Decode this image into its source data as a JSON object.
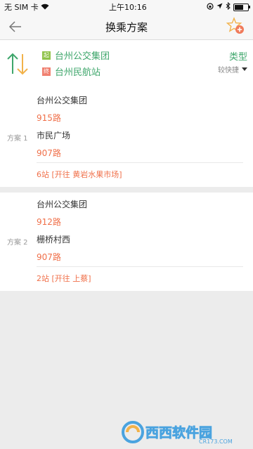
{
  "status": {
    "carrier": "无 SIM 卡",
    "time": "上午10:16"
  },
  "nav": {
    "title": "换乘方案"
  },
  "route": {
    "from_tag": "起",
    "to_tag": "终",
    "from": "台州公交集团",
    "to": "台州民航站",
    "type_label": "类型",
    "type_value": "较快捷"
  },
  "plans": [
    {
      "label": "方案 1",
      "segments": [
        "台州公交集团",
        "915路",
        "市民广场",
        "907路"
      ],
      "summary": "6站 [开往 黄岩水果市场]"
    },
    {
      "label": "方案 2",
      "segments": [
        "台州公交集团",
        "912路",
        "栅桥村西",
        "907路"
      ],
      "summary": "2站 [开往 上蔡]"
    }
  ],
  "watermark": {
    "brand": "西西软件园",
    "url": "CR173.COM"
  },
  "colors": {
    "accent_green": "#3ea66b",
    "route_orange": "#f0704a",
    "from_tag": "#8fc34a",
    "to_tag": "#f08070"
  }
}
